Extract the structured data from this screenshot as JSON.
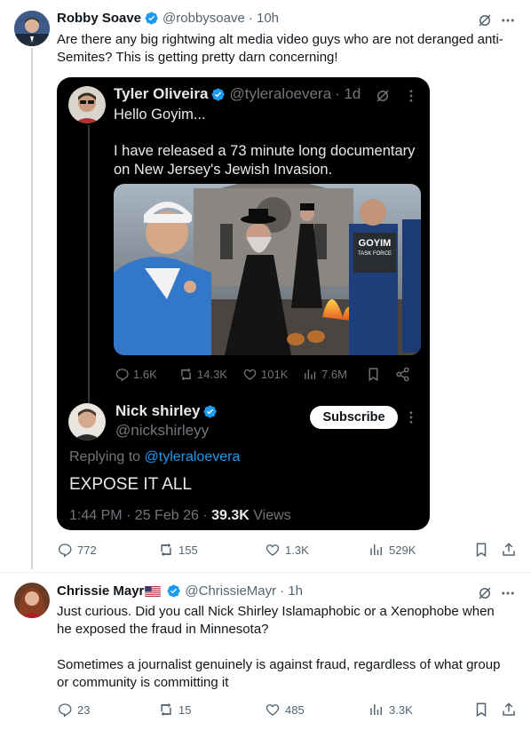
{
  "tweet1": {
    "name": "Robby Soave",
    "handle": "@robbysoave",
    "time": "· 10h",
    "text_line1": "Are there any big rightwing alt media video guys who are not deranged anti-",
    "text_line2": "Semites? This is getting pretty darn concerning!",
    "actions": {
      "replies": "772",
      "reposts": "155",
      "likes": "1.3K",
      "views": "529K"
    }
  },
  "quoted": {
    "name": "Tyler Oliveira",
    "handle": "@tyleraloevera",
    "time": "· 1d",
    "text_line1": "Hello Goyim...",
    "text_line2": "I have released a 73 minute long documentary",
    "text_line3": "on New Jersey's Jewish Invasion.",
    "image_sign": "GOYIM",
    "image_vest": "TASK FORCE",
    "actions": {
      "replies": "1.6K",
      "reposts": "14.3K",
      "likes": "101K",
      "views": "7.6M"
    }
  },
  "reply_in_card": {
    "name": "Nick shirley",
    "handle": "@nickshirleyy",
    "subscribe_label": "Subscribe",
    "replying_to_prefix": "Replying to",
    "replying_to_handle": "@tyleraloevera",
    "text": "EXPOSE IT ALL",
    "timestamp": "1:44 PM · 25 Feb 26 ·",
    "views_count": "39.3K",
    "views_label": "Views"
  },
  "tweet2": {
    "name": "Chrissie Mayr",
    "handle": "@ChrissieMayr",
    "time": "· 1h",
    "text_line1": "Just curious. Did you call Nick Shirley Islamaphobic or a Xenophobe when",
    "text_line2": "he exposed the fraud in Minnesota?",
    "text_line3": "Sometimes a journalist genuinely is against fraud, regardless of what group",
    "text_line4": "or community is committing it",
    "actions": {
      "replies": "23",
      "reposts": "15",
      "likes": "485",
      "views": "3.3K"
    }
  },
  "colors": {
    "accent": "#1d9bf0",
    "muted": "#536471",
    "card_bg": "#000000"
  }
}
